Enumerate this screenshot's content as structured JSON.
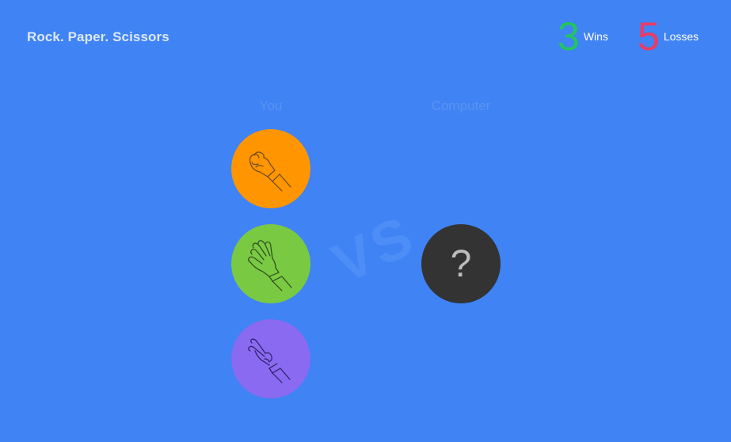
{
  "header": {
    "title": "Rock. Paper. Scissors"
  },
  "scoreboard": {
    "wins": {
      "value": "3",
      "label": "Wins",
      "color": "#22c55e"
    },
    "losses": {
      "value": "5",
      "label": "Losses",
      "color": "#ec3a63"
    }
  },
  "columns": {
    "player_label": "You",
    "computer_label": "Computer"
  },
  "player_choices": [
    {
      "name": "rock",
      "icon": "fist-hand-icon",
      "color": "#ff9500"
    },
    {
      "name": "paper",
      "icon": "open-hand-icon",
      "color": "#7ac943"
    },
    {
      "name": "scissors",
      "icon": "peace-hand-icon",
      "color": "#8a6af0"
    }
  ],
  "versus_text": "VS",
  "computer_choice": {
    "symbol": "?",
    "color": "#333333"
  },
  "colors": {
    "background": "#3f83f5"
  }
}
